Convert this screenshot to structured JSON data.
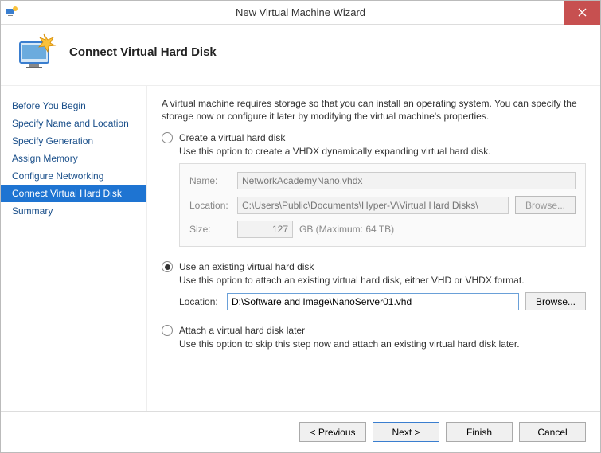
{
  "window": {
    "title": "New Virtual Machine Wizard"
  },
  "header": {
    "title": "Connect Virtual Hard Disk"
  },
  "steps": [
    {
      "label": "Before You Begin"
    },
    {
      "label": "Specify Name and Location"
    },
    {
      "label": "Specify Generation"
    },
    {
      "label": "Assign Memory"
    },
    {
      "label": "Configure Networking"
    },
    {
      "label": "Connect Virtual Hard Disk"
    },
    {
      "label": "Summary"
    }
  ],
  "active_step_index": 5,
  "intro": "A virtual machine requires storage so that you can install an operating system. You can specify the storage now or configure it later by modifying the virtual machine's properties.",
  "option_create": {
    "label": "Create a virtual hard disk",
    "desc": "Use this option to create a VHDX dynamically expanding virtual hard disk.",
    "name_label": "Name:",
    "name_value": "NetworkAcademyNano.vhdx",
    "location_label": "Location:",
    "location_value": "C:\\Users\\Public\\Documents\\Hyper-V\\Virtual Hard Disks\\",
    "browse_label": "Browse...",
    "size_label": "Size:",
    "size_value": "127",
    "size_unit": "GB (Maximum: 64 TB)"
  },
  "option_existing": {
    "label": "Use an existing virtual hard disk",
    "desc": "Use this option to attach an existing virtual hard disk, either VHD or VHDX format.",
    "location_label": "Location:",
    "location_value": "D:\\Software and Image\\NanoServer01.vhd",
    "browse_label": "Browse..."
  },
  "option_later": {
    "label": "Attach a virtual hard disk later",
    "desc": "Use this option to skip this step now and attach an existing virtual hard disk later."
  },
  "selected_option": "existing",
  "footer": {
    "previous": "< Previous",
    "next": "Next >",
    "finish": "Finish",
    "cancel": "Cancel"
  }
}
